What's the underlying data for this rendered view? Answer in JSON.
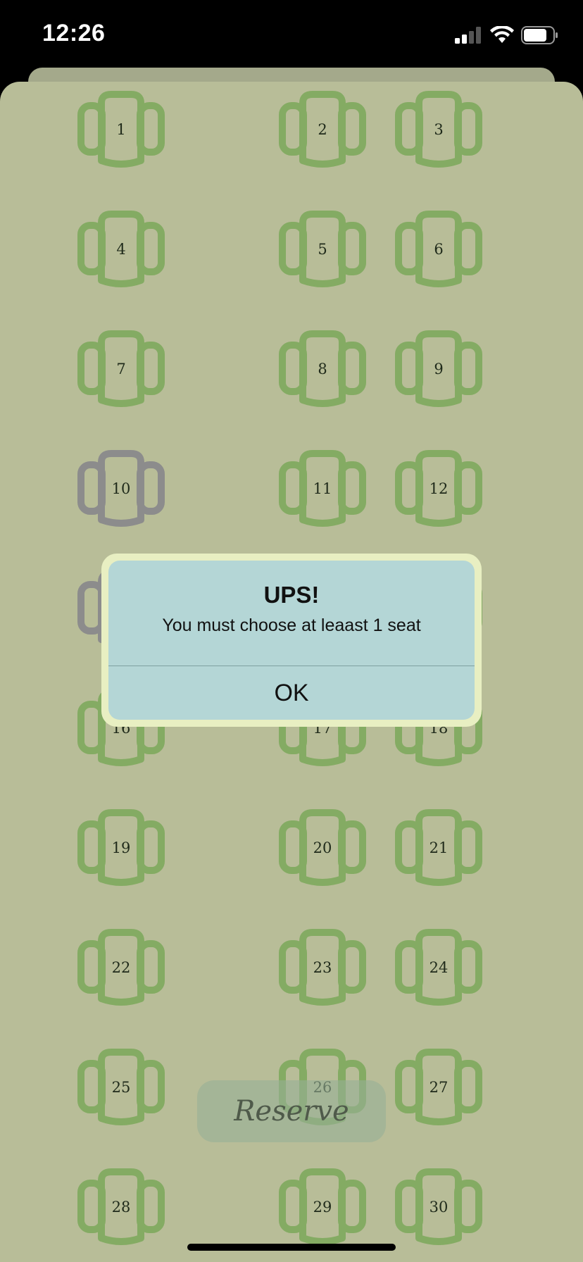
{
  "status_bar": {
    "time": "12:26"
  },
  "seats": {
    "available_color": "#84ab63",
    "occupied_color": "#8c8c8c",
    "items": [
      {
        "number": "1",
        "status": "available"
      },
      {
        "number": "2",
        "status": "available"
      },
      {
        "number": "3",
        "status": "available"
      },
      {
        "number": "4",
        "status": "available"
      },
      {
        "number": "5",
        "status": "available"
      },
      {
        "number": "6",
        "status": "available"
      },
      {
        "number": "7",
        "status": "available"
      },
      {
        "number": "8",
        "status": "available"
      },
      {
        "number": "9",
        "status": "available"
      },
      {
        "number": "10",
        "status": "occupied"
      },
      {
        "number": "11",
        "status": "available"
      },
      {
        "number": "12",
        "status": "available"
      },
      {
        "number": "",
        "status": "occupied"
      },
      {
        "number": "",
        "status": "available"
      },
      {
        "number": "",
        "status": "available"
      },
      {
        "number": "16",
        "status": "available"
      },
      {
        "number": "17",
        "status": "available"
      },
      {
        "number": "18",
        "status": "available"
      },
      {
        "number": "19",
        "status": "available"
      },
      {
        "number": "20",
        "status": "available"
      },
      {
        "number": "21",
        "status": "available"
      },
      {
        "number": "22",
        "status": "available"
      },
      {
        "number": "23",
        "status": "available"
      },
      {
        "number": "24",
        "status": "available"
      },
      {
        "number": "25",
        "status": "available"
      },
      {
        "number": "26",
        "status": "available"
      },
      {
        "number": "27",
        "status": "available"
      },
      {
        "number": "28",
        "status": "available"
      },
      {
        "number": "29",
        "status": "available"
      },
      {
        "number": "30",
        "status": "available"
      }
    ]
  },
  "reserve_button": {
    "label": "Reserve"
  },
  "alert": {
    "title": "UPS!",
    "message": "You must choose at leaast 1 seat",
    "ok_label": "OK"
  }
}
